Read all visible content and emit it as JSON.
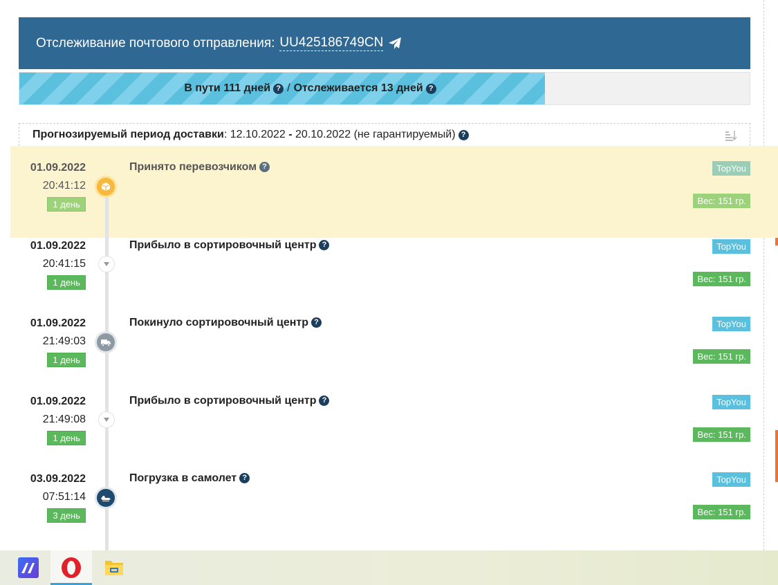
{
  "header": {
    "title": "Отслеживание почтового отправления:",
    "tracking_number": "UU425186749CN",
    "icon": "paper-plane-icon"
  },
  "progress": {
    "in_transit": "В пути 111 дней",
    "separator": "/",
    "tracked": "Отслеживается 13 дней",
    "fill_fraction": 0.72,
    "fill_color": "#5bc0de"
  },
  "forecast": {
    "label": "Прогнозируемый период доставки",
    "colon": ":",
    "start": "12.10.2022",
    "dash": "-",
    "end": "20.10.2022",
    "note": "(не гарантируемый)"
  },
  "events": [
    {
      "date": "01.09.2022",
      "time": "20:41:12",
      "days": "1 день",
      "status": "Принято перевозчиком",
      "carrier": "TopYou",
      "weight": "Вес: 151 гр.",
      "icon": "package-icon",
      "highlighted": true
    },
    {
      "date": "01.09.2022",
      "time": "20:41:15",
      "days": "1 день",
      "status": "Прибыло в сортировочный центр",
      "carrier": "TopYou",
      "weight": "Вес: 151 гр.",
      "icon": "arrow-down-icon",
      "highlighted": false
    },
    {
      "date": "01.09.2022",
      "time": "21:49:03",
      "days": "1 день",
      "status": "Покинуло сортировочный центр",
      "carrier": "TopYou",
      "weight": "Вес: 151 гр.",
      "icon": "truck-icon",
      "highlighted": false
    },
    {
      "date": "01.09.2022",
      "time": "21:49:08",
      "days": "1 день",
      "status": "Прибыло в сортировочный центр",
      "carrier": "TopYou",
      "weight": "Вес: 151 гр.",
      "icon": "arrow-down-icon",
      "highlighted": false
    },
    {
      "date": "03.09.2022",
      "time": "07:51:14",
      "days": "3 день",
      "status": "Погрузка в самолет",
      "carrier": "TopYou",
      "weight": "Вес: 151 гр.",
      "icon": "airplane-icon",
      "highlighted": false
    }
  ],
  "taskbar": {
    "apps": [
      {
        "icon": "ai-app-icon"
      },
      {
        "icon": "opera-browser-icon",
        "active": true
      },
      {
        "icon": "file-explorer-icon"
      }
    ]
  },
  "colors": {
    "header_bg": "#2e6893",
    "highlight_bg": "#fbf4cf",
    "days_badge": "#5cb85c",
    "carrier_badge": "#5bc0de"
  }
}
